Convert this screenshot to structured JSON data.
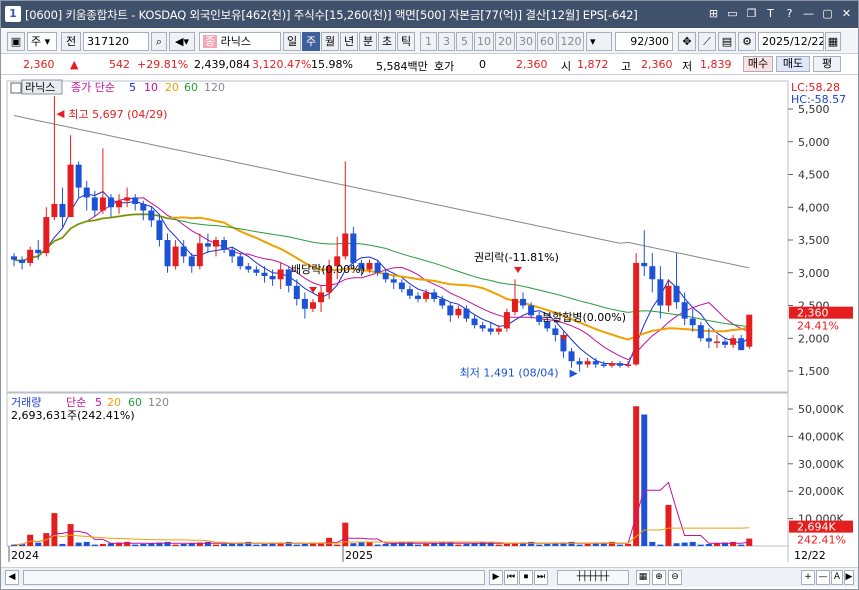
{
  "window": {
    "badge": "1",
    "title": "[0600] 키움종합차트 - KOSDAQ 외국인보유[462(천)] 주식수[15,260(천)] 액면[500] 자본금[77(억)] 결산[12월] EPS[-642]",
    "buttons": [
      "⊞",
      "▭",
      "❐",
      "T",
      "?",
      "—",
      "▢",
      "✕"
    ]
  },
  "toolbar": {
    "period_select": "주",
    "prev_label": "전",
    "code": "317120",
    "stock_name": "라닉스",
    "period_tabs": [
      "일",
      "주",
      "월",
      "년",
      "분",
      "초",
      "틱"
    ],
    "active_period": "주",
    "numbers": [
      "1",
      "3",
      "5",
      "10",
      "20",
      "30",
      "60",
      "120"
    ],
    "count": "92",
    "count_total": "/300",
    "date": "2025/12/22"
  },
  "infobar": {
    "price": "2,360",
    "change": "542",
    "change_pct": "+29.81%",
    "volume": "2,439,084",
    "volume_pct": "3,120.47%",
    "turnover": "15.98%",
    "amount": "5,584백만",
    "quote_label": "호가",
    "quote_value": "0",
    "quote_price": "2,360",
    "open_label": "시",
    "open": "1,872",
    "high_label": "고",
    "high": "2,360",
    "low_label": "저",
    "low": "1,839",
    "buy_label": "매수",
    "sell_label": "매도",
    "eval_label": "평"
  },
  "price_panel": {
    "stock_tag": "라닉스",
    "ma_label": "종가 단순",
    "ma_periods": [
      {
        "p": "5",
        "color": "#1a2bd6"
      },
      {
        "p": "10",
        "color": "#c2119c"
      },
      {
        "p": "20",
        "color": "#f0a000"
      },
      {
        "p": "60",
        "color": "#2a9b3a"
      },
      {
        "p": "120",
        "color": "#888888"
      }
    ],
    "lc_label": "LC:58.28",
    "hc_label": "HC:-58.57",
    "max_label": "최고 5,697 (04/29)",
    "min_label": "최저 1,491 (08/04)",
    "events": [
      {
        "label": "배당락(0.00%)",
        "x": 312
      },
      {
        "label": "권리락(-11.81%)",
        "x": 517
      },
      {
        "label": "분할합병(0.00%)",
        "x": 563
      }
    ],
    "current_price_tag": "2,360",
    "current_pct_tag": "24.41%",
    "yticks": [
      "5,500",
      "5,000",
      "4,500",
      "4,000",
      "3,500",
      "3,000",
      "2,500",
      "2,000",
      "1,500"
    ]
  },
  "volume_panel": {
    "label": "거래량",
    "ma_label": "단순",
    "ma_periods": [
      {
        "p": "5",
        "color": "#c2119c"
      },
      {
        "p": "20",
        "color": "#f0a000"
      },
      {
        "p": "60",
        "color": "#2a9b3a"
      },
      {
        "p": "120",
        "color": "#888888"
      }
    ],
    "value_label": "2,693,631주(242.41%)",
    "yticks": [
      "50,000K",
      "40,000K",
      "30,000K",
      "20,000K",
      "10,000K"
    ],
    "current_tag": "2,694K",
    "current_pct_tag": "242.41%"
  },
  "xaxis": {
    "labels": [
      {
        "text": "2024",
        "x": 8
      },
      {
        "text": "2025",
        "x": 342
      }
    ],
    "last_label": "12/22"
  },
  "colors": {
    "up": "#e41e1e",
    "down": "#1c52d6",
    "titlebar": "#40516b"
  },
  "scrollbar": {
    "buttons": [
      "◀",
      "▶",
      "⏮",
      "⏹",
      "⏭",
      "▦",
      "⊕",
      "⊖",
      "+",
      "—",
      "A",
      "▶"
    ]
  }
}
